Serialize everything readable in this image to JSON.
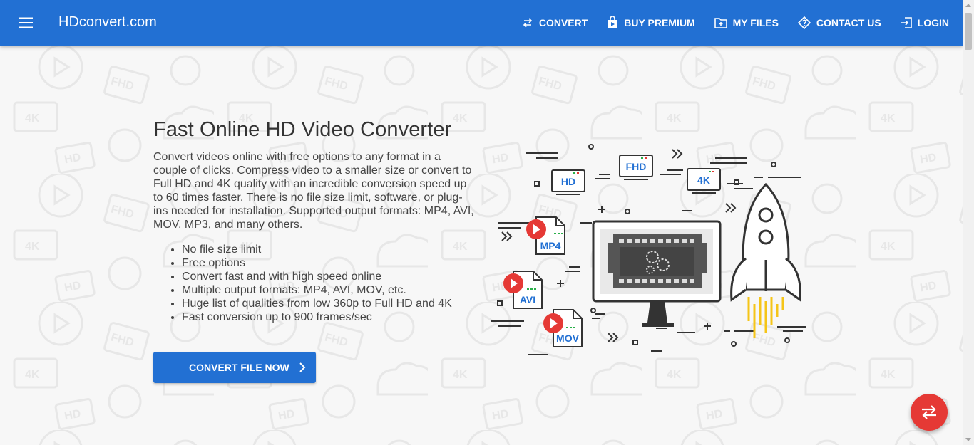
{
  "brand": {
    "name": "HDconvert.com"
  },
  "nav": {
    "convert": "CONVERT",
    "buy_premium": "BUY PREMIUM",
    "my_files": "MY FILES",
    "contact_us": "CONTACT US",
    "login": "LOGIN"
  },
  "hero": {
    "title": "Fast Online HD Video Converter",
    "description": "Convert videos online with free options to any format in a couple of clicks. Compress video to a smaller size or convert to Full HD and 4K quality with an incredible conversion speed up to 60 times faster. There is no file size limit, software, or plug-ins needed for installation. Supported output formats: MP4, AVI, MOV, MP3, and many others.",
    "features": [
      "No file size limit",
      "Free options",
      "Convert fast and with high speed online",
      "Multiple output formats: MP4, AVI, MOV, etc.",
      "Huge list of qualities from low 360p to Full HD and 4K",
      "Fast conversion up to 900 frames/sec"
    ],
    "cta_label": "CONVERT FILE NOW"
  },
  "illustration": {
    "screens": [
      "HD",
      "FHD",
      "4K"
    ],
    "files": [
      "MP4",
      "AVI",
      "MOV"
    ]
  },
  "icons": {
    "menu": "menu-icon",
    "convert": "swap-arrows-icon",
    "buy_premium": "shopping-bag-icon",
    "my_files": "folder-icon",
    "contact_us": "diamond-question-icon",
    "login": "login-icon",
    "cta": "chevron-right-icon",
    "fab": "swap-arrows-icon"
  },
  "colors": {
    "primary": "#2270d3",
    "fab": "#e53935",
    "background": "#f7f7f7",
    "text": "#333333",
    "accent_red": "#e53935",
    "accent_yellow": "#f5c518"
  }
}
